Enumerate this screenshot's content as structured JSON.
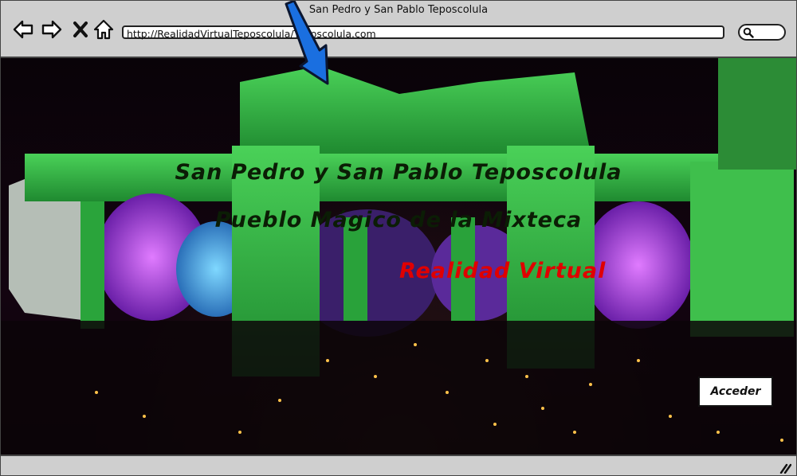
{
  "window": {
    "title": "San Pedro y San Pablo Teposcolula"
  },
  "browser": {
    "url": "http://RealidadVirtualTeposcolula/Teposcolula.com",
    "nav": {
      "back": "arrow-left-icon",
      "forward": "arrow-right-icon",
      "close": "close-icon",
      "home": "home-icon"
    },
    "search_icon": "search-icon"
  },
  "hero": {
    "title": "San Pedro y San Pablo Teposcolula",
    "subtitle": "Pueblo Mágico de la Mixteca",
    "tagline": "Realidad Virtual",
    "tagline_color": "#e00000"
  },
  "actions": {
    "access_label": "Acceder"
  },
  "colors": {
    "chrome": "#cfcfcf",
    "arrow": "#1a6fe0",
    "arches": "#2fbf3f",
    "lights": "#b43cf0"
  }
}
